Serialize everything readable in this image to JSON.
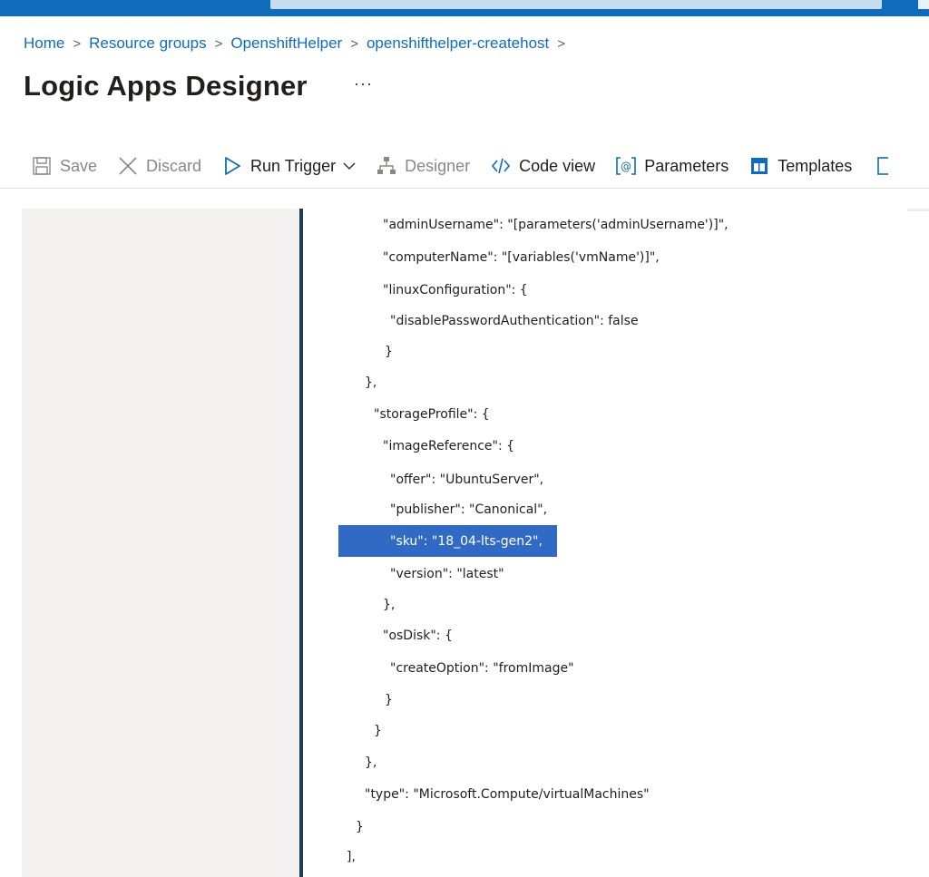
{
  "breadcrumb": {
    "items": [
      "Home",
      "Resource groups",
      "OpenshiftHelper",
      "openshifthelper-createhost"
    ],
    "separator": ">"
  },
  "page": {
    "title": "Logic Apps Designer",
    "more_label": "···"
  },
  "toolbar": {
    "save": "Save",
    "discard": "Discard",
    "run_trigger": "Run Trigger",
    "designer": "Designer",
    "code_view": "Code view",
    "parameters": "Parameters",
    "templates": "Templates"
  },
  "code": {
    "lines": [
      "\"adminUsername\": \"[parameters('adminUsername')]\",",
      "\"computerName\": \"[variables('vmName')]\",",
      "\"linuxConfiguration\": {",
      "\"disablePasswordAuthentication\": false",
      "}",
      "},",
      "\"storageProfile\": {",
      "\"imageReference\": {",
      "\"offer\": \"UbuntuServer\",",
      "\"publisher\": \"Canonical\",",
      "\"sku\": \"18_04-lts-gen2\",",
      "\"version\": \"latest\"",
      "},",
      "\"osDisk\": {",
      "\"createOption\": \"fromImage\"",
      "}",
      "}",
      "},",
      "\"type\": \"Microsoft.Compute/virtualMachines\"",
      "}",
      "],"
    ],
    "selected_line_index": 10
  },
  "colors": {
    "accent": "#0f6cbd",
    "selection": "#316ac5",
    "editor_border": "#1f3a5f"
  }
}
